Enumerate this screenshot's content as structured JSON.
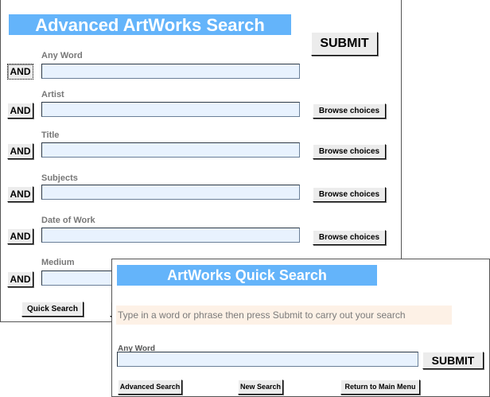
{
  "advanced": {
    "title": "Advanced ArtWorks Search",
    "submit_label": "SUBMIT",
    "fields": [
      {
        "label": "Any Word",
        "and_label": "AND",
        "browse_label": ""
      },
      {
        "label": "Artist",
        "and_label": "AND",
        "browse_label": "Browse choices"
      },
      {
        "label": "Title",
        "and_label": "AND",
        "browse_label": "Browse choices"
      },
      {
        "label": "Subjects",
        "and_label": "AND",
        "browse_label": "Browse choices"
      },
      {
        "label": "Date of Work",
        "and_label": "AND",
        "browse_label": "Browse choices"
      },
      {
        "label": "Medium",
        "and_label": "AND",
        "browse_label": ""
      }
    ],
    "quick_search_label": "Quick Search"
  },
  "quick": {
    "title": "ArtWorks Quick Search",
    "hint": "Type in a word or phrase then press Submit to carry out your search",
    "field_label": "Any Word",
    "submit_label": "SUBMIT",
    "advanced_label": "Advanced Search",
    "new_label": "New Search",
    "main_menu_label": "Return to Main Menu"
  },
  "colors": {
    "banner": "#64b4fa",
    "input_fill": "#e8f2fe",
    "hint_fill": "#fdf1e6"
  }
}
